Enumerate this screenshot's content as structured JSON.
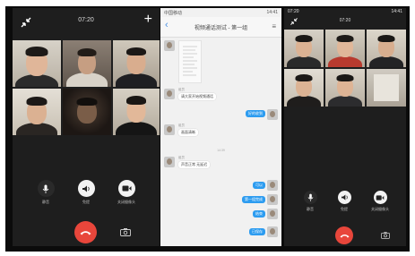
{
  "screen_left": {
    "top_bar": {
      "time": "07:20",
      "add_icon": "+"
    },
    "controls": [
      {
        "icon": "mic-icon",
        "label": "静音"
      },
      {
        "icon": "speaker-icon",
        "label": "免提"
      },
      {
        "icon": "camera-icon",
        "label": "关闭摄像头"
      }
    ]
  },
  "screen_chat": {
    "status": {
      "left": "中国移动",
      "right": "14:41"
    },
    "title": "视频通话测试 - 第一组",
    "messages": [
      {
        "side": "in",
        "nick": "组员",
        "text": "请大家开始视频通话"
      },
      {
        "side": "out",
        "text": "好的收到"
      },
      {
        "side": "in",
        "nick": "组员",
        "text": "画面清晰"
      },
      {
        "side": "in",
        "nick": "组员",
        "text": "声音正常 无延迟"
      },
      {
        "side": "out",
        "text": "可以"
      },
      {
        "side": "out",
        "text": "第一组完成"
      },
      {
        "side": "out",
        "text": "结束"
      },
      {
        "side": "out",
        "text": "已保存"
      }
    ],
    "timestamp": "14:39"
  },
  "screen_right": {
    "status": {
      "time": "07:20",
      "right": "14:41"
    },
    "top_bar": {
      "time": "07:20"
    },
    "controls": [
      {
        "icon": "mic-icon",
        "label": "静音"
      },
      {
        "icon": "speaker-icon",
        "label": "免提"
      },
      {
        "icon": "camera-icon",
        "label": "关闭摄像头"
      }
    ]
  },
  "colors": {
    "call_bg": "#1e1e1e",
    "hangup": "#e8463b",
    "chat_bubble": "#2d9cf0"
  }
}
